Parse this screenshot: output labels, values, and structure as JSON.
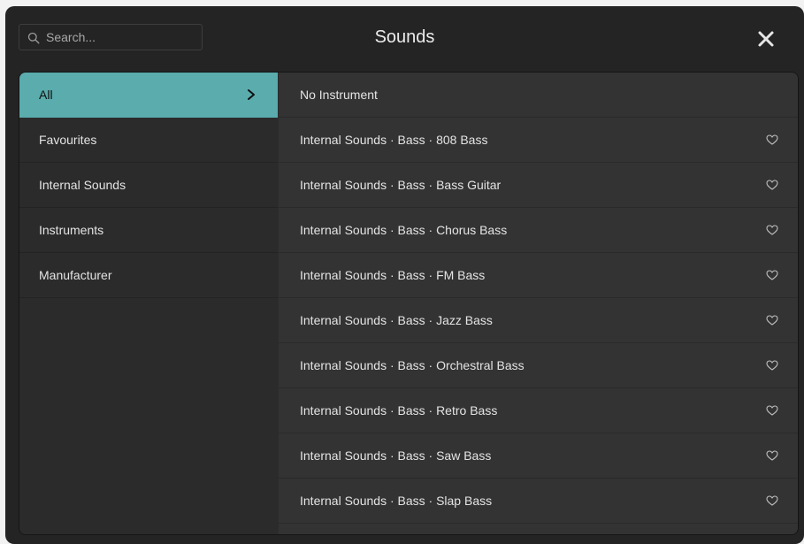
{
  "header": {
    "title": "Sounds",
    "search_placeholder": "Search...",
    "search_value": "",
    "close_icon": "close-icon"
  },
  "sidebar": {
    "items": [
      {
        "label": "All",
        "active": true,
        "chevron": true
      },
      {
        "label": "Favourites"
      },
      {
        "label": "Internal Sounds"
      },
      {
        "label": "Instruments"
      },
      {
        "label": "Manufacturer"
      }
    ]
  },
  "list": {
    "items": [
      {
        "label": "No Instrument",
        "favouritable": false
      },
      {
        "label": "Internal Sounds · Bass · 808 Bass",
        "favouritable": true
      },
      {
        "label": "Internal Sounds · Bass · Bass Guitar",
        "favouritable": true
      },
      {
        "label": "Internal Sounds · Bass · Chorus Bass",
        "favouritable": true
      },
      {
        "label": "Internal Sounds · Bass · FM Bass",
        "favouritable": true
      },
      {
        "label": "Internal Sounds · Bass · Jazz Bass",
        "favouritable": true
      },
      {
        "label": "Internal Sounds · Bass · Orchestral Bass",
        "favouritable": true
      },
      {
        "label": "Internal Sounds · Bass · Retro Bass",
        "favouritable": true
      },
      {
        "label": "Internal Sounds · Bass · Saw Bass",
        "favouritable": true
      },
      {
        "label": "Internal Sounds · Bass · Slap Bass",
        "favouritable": true
      }
    ]
  },
  "colors": {
    "accent": "#5aacad",
    "window_bg": "#242424",
    "sidebar_bg": "#2b2b2b",
    "list_bg": "#333333",
    "text": "#e4e4e4"
  }
}
